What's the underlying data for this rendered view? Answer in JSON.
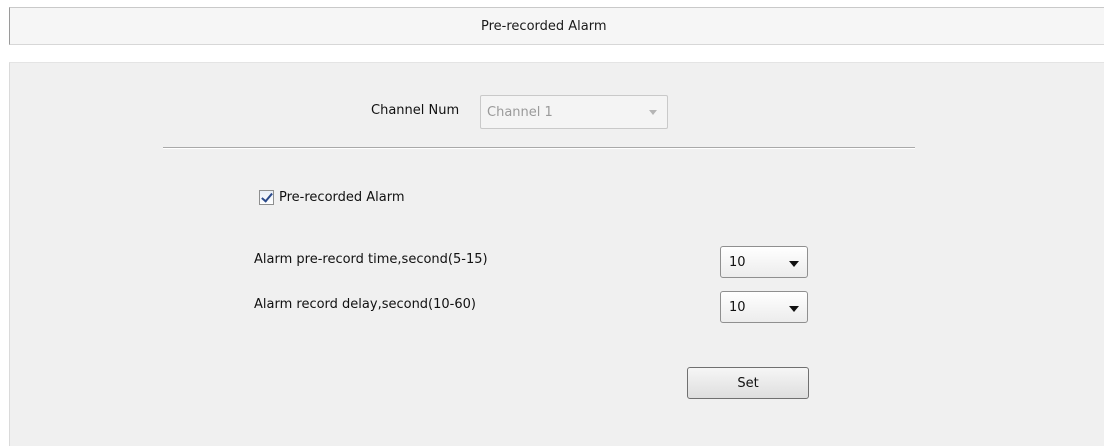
{
  "header": {
    "title": "Pre-recorded Alarm"
  },
  "channel": {
    "label": "Channel Num",
    "value": "Channel 1"
  },
  "prerecord_checkbox": {
    "label": "Pre-recorded Alarm",
    "checked": true
  },
  "settings": [
    {
      "label": "Alarm pre-record time,second(5-15)",
      "value": "10"
    },
    {
      "label": "Alarm record delay,second(10-60)",
      "value": "10"
    }
  ],
  "set_button": {
    "label": "Set"
  }
}
